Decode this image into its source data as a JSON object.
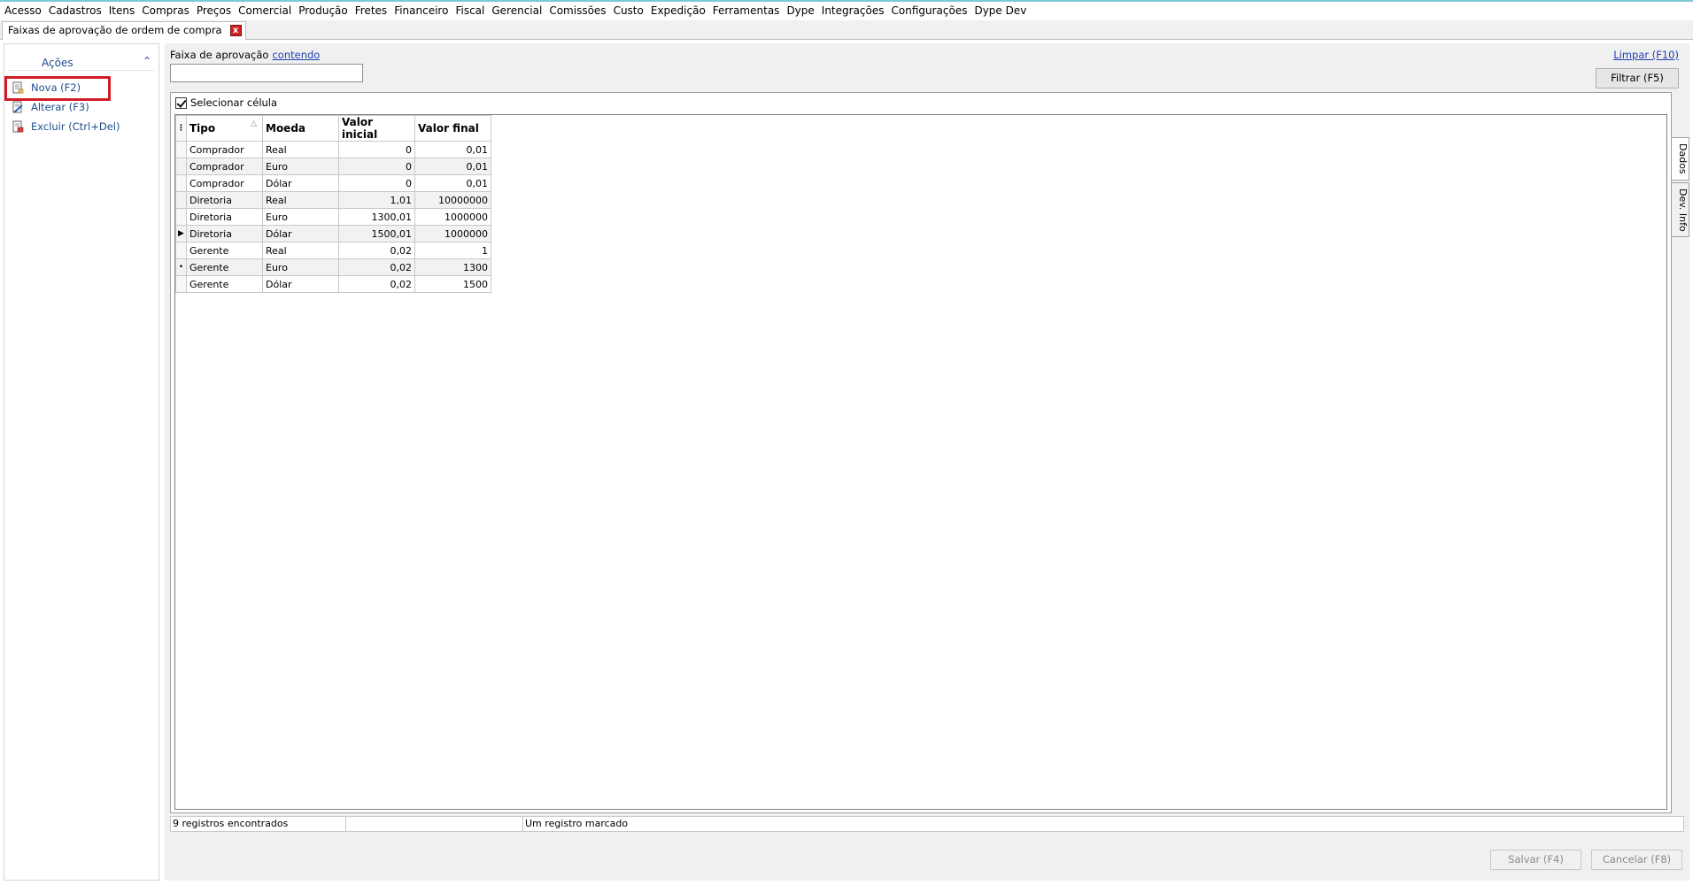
{
  "menu": [
    "Acesso",
    "Cadastros",
    "Itens",
    "Compras",
    "Preços",
    "Comercial",
    "Produção",
    "Fretes",
    "Financeiro",
    "Fiscal",
    "Gerencial",
    "Comissões",
    "Custo",
    "Expedição",
    "Ferramentas",
    "Dype",
    "Integrações",
    "Configurações",
    "Dype Dev"
  ],
  "tab": {
    "title": "Faixas de aprovação de ordem de compra",
    "close_icon": "close-icon",
    "close_glyph": "x"
  },
  "sidebar": {
    "title": "Ações",
    "collapse_glyph": "⌃",
    "actions": [
      {
        "label": "Nova (F2)",
        "icon": "new-document-icon"
      },
      {
        "label": "Alterar (F3)",
        "icon": "edit-document-icon"
      },
      {
        "label": "Excluir (Ctrl+Del)",
        "icon": "delete-document-icon"
      }
    ]
  },
  "filter": {
    "label": "Faixa de aprovação",
    "operator_link": "contendo",
    "value": "",
    "clear_link": "Limpar (F10)",
    "filter_button": "Filtrar (F5)"
  },
  "grid": {
    "select_cell_label": "Selecionar célula",
    "select_cell_checked": true,
    "columns": [
      "Tipo",
      "Moeda",
      "Valor inicial",
      "Valor final"
    ],
    "rows": [
      {
        "indicator": "",
        "tipo": "Comprador",
        "moeda": "Real",
        "valor_inicial": "0",
        "valor_final": "0,01"
      },
      {
        "indicator": "",
        "tipo": "Comprador",
        "moeda": "Euro",
        "valor_inicial": "0",
        "valor_final": "0,01"
      },
      {
        "indicator": "",
        "tipo": "Comprador",
        "moeda": "Dólar",
        "valor_inicial": "0",
        "valor_final": "0,01"
      },
      {
        "indicator": "",
        "tipo": "Diretoria",
        "moeda": "Real",
        "valor_inicial": "1,01",
        "valor_final": "10000000"
      },
      {
        "indicator": "",
        "tipo": "Diretoria",
        "moeda": "Euro",
        "valor_inicial": "1300,01",
        "valor_final": "1000000"
      },
      {
        "indicator": "▶",
        "tipo": "Diretoria",
        "moeda": "Dólar",
        "valor_inicial": "1500,01",
        "valor_final": "1000000"
      },
      {
        "indicator": "",
        "tipo": "Gerente",
        "moeda": "Real",
        "valor_inicial": "0,02",
        "valor_final": "1"
      },
      {
        "indicator": "•",
        "tipo": "Gerente",
        "moeda": "Euro",
        "valor_inicial": "0,02",
        "valor_final": "1300"
      },
      {
        "indicator": "",
        "tipo": "Gerente",
        "moeda": "Dólar",
        "valor_inicial": "0,02",
        "valor_final": "1500"
      }
    ]
  },
  "side_tabs": [
    "Dados",
    "Dev. Info"
  ],
  "status": {
    "records_found": "9 registros encontrados",
    "middle": "",
    "marked": "Um registro marcado"
  },
  "buttons": {
    "save": "Salvar (F4)",
    "cancel": "Cancelar (F8)"
  },
  "colors": {
    "highlight": "#d01c25",
    "link": "#1f3fb0",
    "action_text": "#1f4e8c",
    "close": "#cc2222"
  }
}
